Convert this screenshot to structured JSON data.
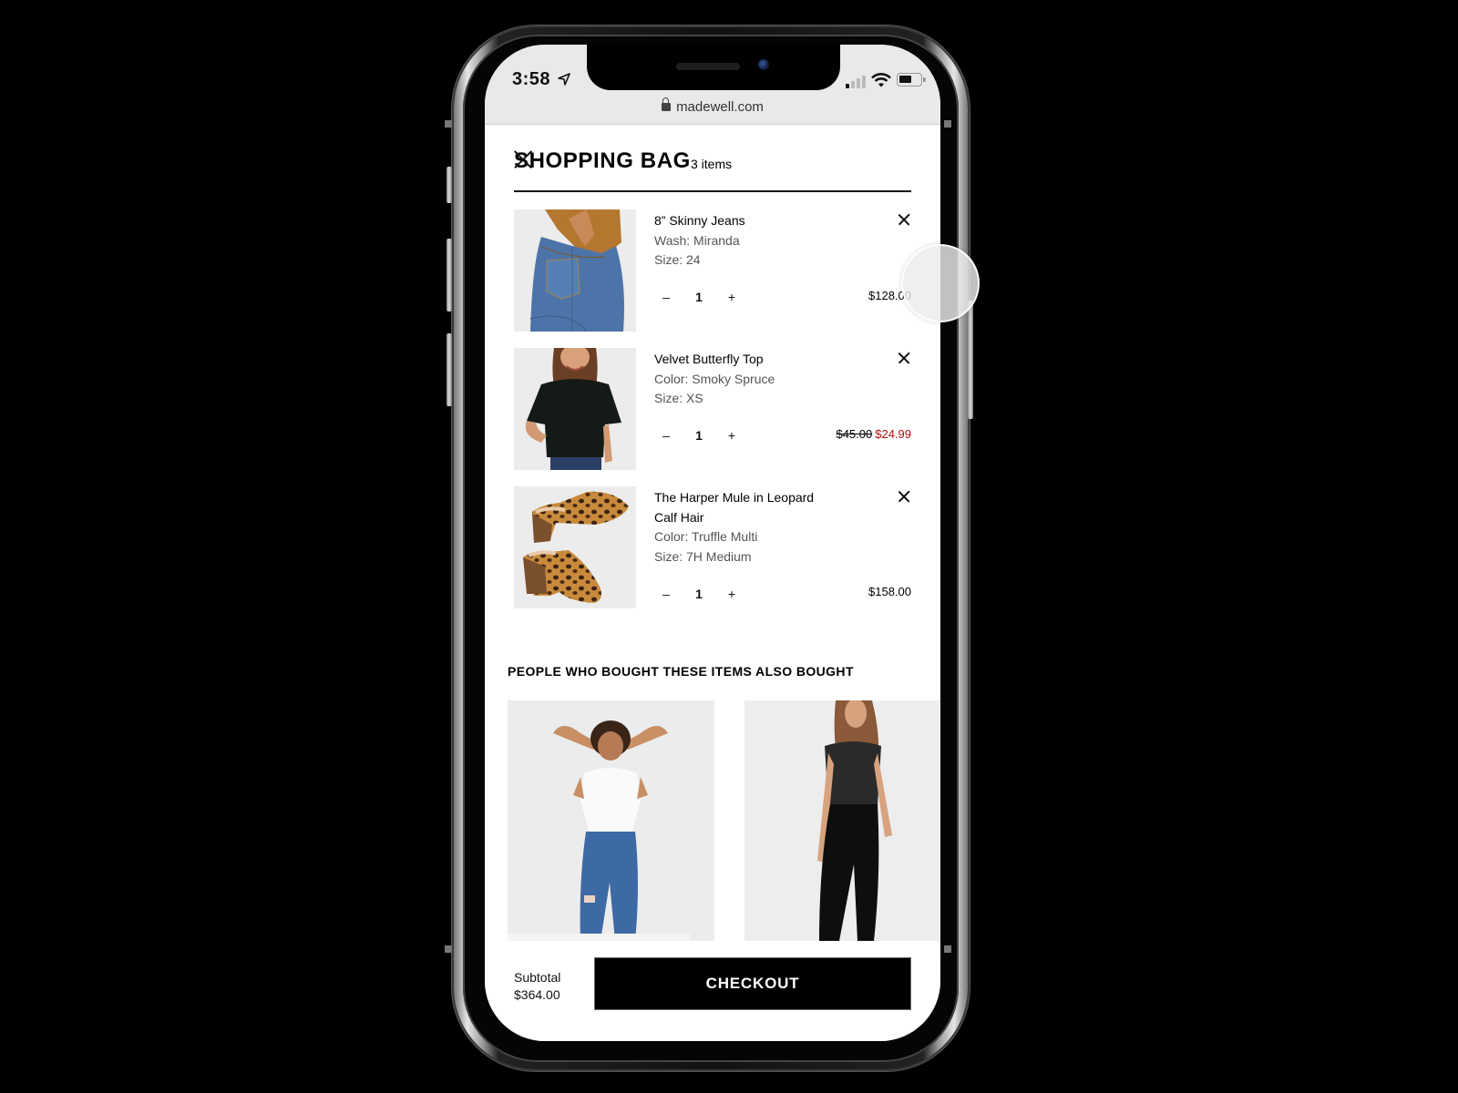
{
  "status_bar": {
    "time": "3:58",
    "url": "madewell.com",
    "icons": [
      "location-arrow-icon",
      "cellular-signal-icon",
      "wifi-icon",
      "battery-icon"
    ]
  },
  "bag": {
    "title": "SHOPPING BAG",
    "count_label": "3 items",
    "close_icon": "close-icon"
  },
  "items": [
    {
      "name": "8” Skinny Jeans",
      "attr1": "Wash: Miranda",
      "attr2": "Size: 24",
      "qty_minus": "–",
      "qty": "1",
      "qty_plus": "+",
      "price": "$128.00",
      "image": "blue skinny jeans"
    },
    {
      "name": "Velvet Butterfly Top",
      "attr1": "Color: Smoky Spruce",
      "attr2": "Size: XS",
      "qty_minus": "–",
      "qty": "1",
      "qty_plus": "+",
      "original_price": "$45.00",
      "sale_price": "$24.99",
      "image": "black velvet top"
    },
    {
      "name": "The Harper Mule in Leopard Calf Hair",
      "attr1": "Color: Truffle Multi",
      "attr2": "Size: 7H Medium",
      "qty_minus": "–",
      "qty": "1",
      "qty_plus": "+",
      "price": "$158.00",
      "image": "leopard mules"
    }
  ],
  "recommendations": {
    "title": "PEOPLE WHO BOUGHT THESE ITEMS ALSO BOUGHT",
    "cards": [
      {
        "image": "woman in white tee and ripped blue skinny jeans"
      },
      {
        "image": "woman in sequin cami and black skinny jeans"
      }
    ]
  },
  "footer": {
    "subtotal_label": "Subtotal",
    "subtotal_value": "$364.00",
    "checkout_label": "CHECKOUT"
  },
  "colors": {
    "sale_red": "#b00d0d",
    "checkout_bg": "#000000",
    "text": "#000000",
    "secondary_text": "#555555"
  }
}
